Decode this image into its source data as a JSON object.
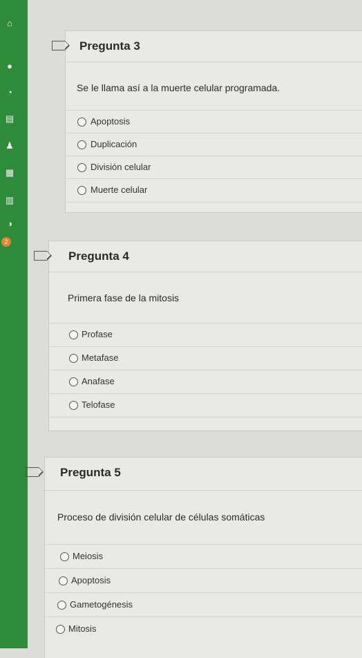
{
  "sidebar": {
    "badge": "2"
  },
  "questions": [
    {
      "title": "Pregunta 3",
      "text": "Se le llama así a la muerte celular programada.",
      "options": [
        "Apoptosis",
        "Duplicación",
        "División celular",
        "Muerte celular"
      ]
    },
    {
      "title": "Pregunta 4",
      "text": "Primera fase de la mitosis",
      "options": [
        "Profase",
        "Metafase",
        "Anafase",
        "Telofase"
      ]
    },
    {
      "title": "Pregunta 5",
      "text": "Proceso de división celular de células somáticas",
      "options": [
        "Meiosis",
        "Apoptosis",
        "Gametogénesis",
        "Mitosis"
      ]
    }
  ]
}
